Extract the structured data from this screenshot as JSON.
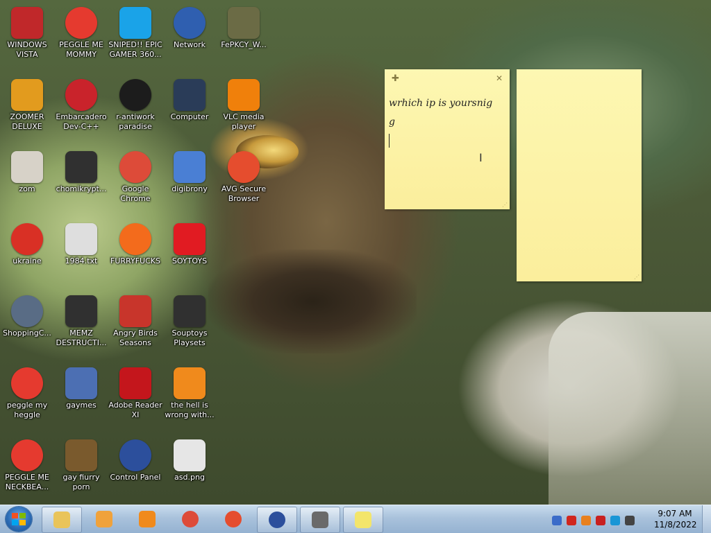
{
  "desktop": {
    "icons": [
      {
        "label": "WINDOWS VISTA",
        "icon": "orb-icon",
        "color": "#c0282a"
      },
      {
        "label": "PEGGLE ME MOMMY",
        "icon": "peggle-icon",
        "color": "#e53a2f"
      },
      {
        "label": "SNIPED!! EPIC GAMER 360...",
        "icon": "skype-icon",
        "color": "#1aa3e8"
      },
      {
        "label": "Network",
        "icon": "network-icon",
        "color": "#2f5fb0"
      },
      {
        "label": "FePKCY_W...",
        "icon": "image-file-icon",
        "color": "#6b6b45"
      },
      {
        "label": "ZOOMER DELUXE",
        "icon": "zoomer-icon",
        "color": "#e29b1e"
      },
      {
        "label": "Embarcadero Dev-C++",
        "icon": "devcpp-icon",
        "color": "#c9232b"
      },
      {
        "label": "r-antiwork paradise",
        "icon": "reddit-icon",
        "color": "#1c1c1c"
      },
      {
        "label": "Computer",
        "icon": "computer-icon",
        "color": "#2a3c58"
      },
      {
        "label": "VLC media player",
        "icon": "vlc-icon",
        "color": "#f0800b"
      },
      {
        "label": "zom",
        "icon": "flower-icon",
        "color": "#d7d2c8"
      },
      {
        "label": "chomikrypt...",
        "icon": "shortcut-icon",
        "color": "#303030"
      },
      {
        "label": "Google Chrome",
        "icon": "chrome-icon",
        "color": "#dd4b39"
      },
      {
        "label": "digibrony",
        "icon": "digibrony-icon",
        "color": "#4a7fd4"
      },
      {
        "label": "AVG Secure Browser",
        "icon": "avg-browser-icon",
        "color": "#e54d2e"
      },
      {
        "label": "ukraine",
        "icon": "radiation-icon",
        "color": "#d93025"
      },
      {
        "label": "1984.txt",
        "icon": "text-file-icon",
        "color": "#dedede"
      },
      {
        "label": "FURRYFUCKS",
        "icon": "firefox-icon",
        "color": "#f36b1c"
      },
      {
        "label": "SOYTOYS",
        "icon": "soytoys-icon",
        "color": "#e11b22"
      },
      {
        "label": "ShoppingC...",
        "icon": "flash-icon",
        "color": "#596c85"
      },
      {
        "label": "MEMZ DESTRUCTI...",
        "icon": "shortcut-icon",
        "color": "#303030"
      },
      {
        "label": "Angry Birds Seasons",
        "icon": "angry-birds-icon",
        "color": "#c8352b"
      },
      {
        "label": "Souptoys Playsets",
        "icon": "shortcut-icon",
        "color": "#303030"
      },
      {
        "label": "peggle my heggle",
        "icon": "peggle-icon",
        "color": "#e53a2f"
      },
      {
        "label": "gaymes",
        "icon": "game-folder-icon",
        "color": "#4c6fb3"
      },
      {
        "label": "Adobe Reader XI",
        "icon": "acrobat-icon",
        "color": "#c4161c"
      },
      {
        "label": "the hell is wrong with...",
        "icon": "uc-browser-icon",
        "color": "#f08a1c"
      },
      {
        "label": "PEGGLE ME NECKBEA...",
        "icon": "peggle-icon",
        "color": "#e53a2f"
      },
      {
        "label": "gay fiurry porn",
        "icon": "box-game-icon",
        "color": "#7a5a2d"
      },
      {
        "label": "Control Panel",
        "icon": "control-panel-icon",
        "color": "#2c4f9c"
      },
      {
        "label": "asd.png",
        "icon": "png-file-icon",
        "color": "#e6e6e6"
      }
    ]
  },
  "sticky_notes": [
    {
      "text": "wrhich ip is yoursnig\ng"
    },
    {
      "text": ""
    }
  ],
  "taskbar": {
    "start_icon": "windows-logo-icon",
    "buttons": [
      {
        "icon": "explorer-folder-icon",
        "color": "#e9c45a"
      },
      {
        "icon": "media-player-icon",
        "color": "#f0a23b"
      },
      {
        "icon": "uc-browser-icon",
        "color": "#f08a1c"
      },
      {
        "icon": "chrome-icon",
        "color": "#dd4b39"
      },
      {
        "icon": "avg-browser-icon",
        "color": "#e54d2e"
      },
      {
        "icon": "control-panel-icon",
        "color": "#2c4f9c"
      },
      {
        "icon": "movie-maker-icon",
        "color": "#6a6a6a"
      },
      {
        "icon": "sticky-notes-icon",
        "color": "#f3e56b"
      }
    ],
    "tray_icons": [
      {
        "icon": "qb-icon",
        "color": "#3b6cc9"
      },
      {
        "icon": "v-icon",
        "color": "#d0261e"
      },
      {
        "icon": "search-tray-icon",
        "color": "#e8801e"
      },
      {
        "icon": "flag-icon",
        "color": "#c82020"
      },
      {
        "icon": "display-icon",
        "color": "#1a96d6"
      },
      {
        "icon": "speaker-icon",
        "color": "#444444"
      }
    ],
    "clock": {
      "time": "9:07 AM",
      "date": "11/8/2022"
    }
  }
}
